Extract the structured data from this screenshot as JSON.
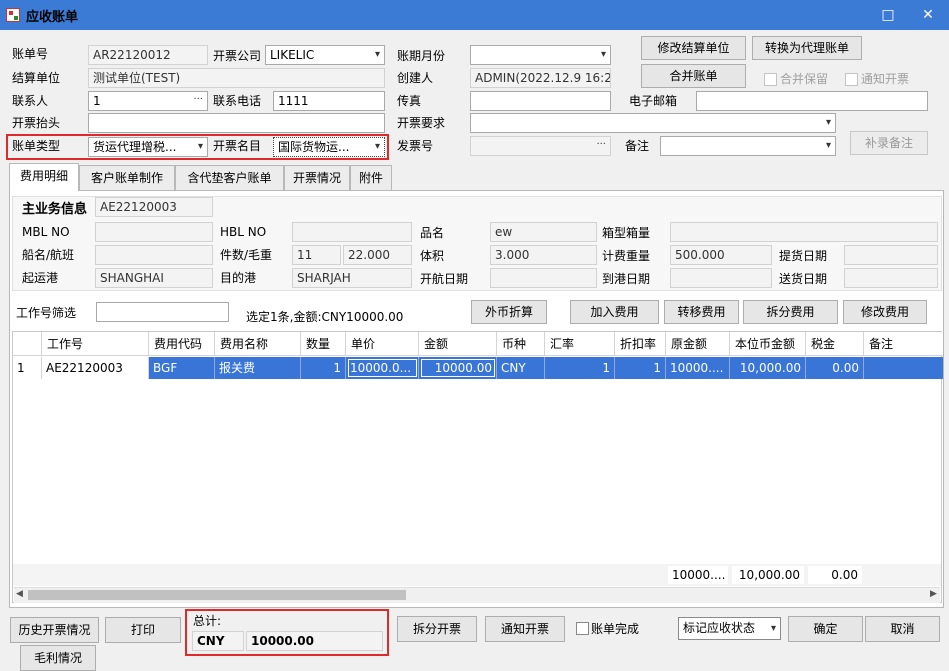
{
  "window": {
    "title": "应收账单",
    "maximize_icon": "□",
    "close_icon": "✕"
  },
  "form": {
    "bill_no": {
      "label": "账单号",
      "value": "AR22120012"
    },
    "invoice_company": {
      "label": "开票公司",
      "value": "LIKELIC"
    },
    "period": {
      "label": "账期月份",
      "value": ""
    },
    "settle_unit": {
      "label": "结算单位",
      "value": "测试单位(TEST)"
    },
    "creator": {
      "label": "创建人",
      "value": "ADMIN(2022.12.9 16:2:"
    },
    "contact": {
      "label": "联系人",
      "value": "1"
    },
    "phone": {
      "label": "联系电话",
      "value": "1111"
    },
    "fax": {
      "label": "传真",
      "value": ""
    },
    "email": {
      "label": "电子邮箱",
      "value": ""
    },
    "invoice_title": {
      "label": "开票抬头",
      "value": ""
    },
    "invoice_req": {
      "label": "开票要求",
      "value": ""
    },
    "bill_type": {
      "label": "账单类型",
      "value": "货运代理增税..."
    },
    "invoice_item": {
      "label": "开票名目",
      "value": "国际货物运..."
    },
    "invoice_no": {
      "label": "发票号",
      "value": ""
    },
    "remark": {
      "label": "备注",
      "value": ""
    }
  },
  "buttons": {
    "modify_settle": "修改结算单位",
    "to_agent": "转换为代理账单",
    "merge": "合并账单",
    "supplement": "补录备注",
    "foreign_convert": "外币折算",
    "add_fee": "加入费用",
    "transfer_fee": "转移费用",
    "split_fee": "拆分费用",
    "modify_fee": "修改费用",
    "history_invoice": "历史开票情况",
    "print": "打印",
    "profit": "毛利情况",
    "split_invoice": "拆分开票",
    "notify_invoice": "通知开票",
    "confirm": "确定",
    "cancel": "取消"
  },
  "checks": {
    "merge_keep": "合并保留",
    "notify_invoice": "通知开票",
    "bill_done": "账单完成"
  },
  "status_select": "标记应收状态",
  "tabs": [
    "费用明细",
    "客户账单制作",
    "含代垫客户账单",
    "开票情况",
    "附件"
  ],
  "biz": {
    "header": "主业务信息",
    "job_no": "AE22120003",
    "mbl": {
      "label": "MBL NO",
      "value": ""
    },
    "hbl": {
      "label": "HBL NO",
      "value": ""
    },
    "product": {
      "label": "品名",
      "value": "ew"
    },
    "container": {
      "label": "箱型箱量",
      "value": ""
    },
    "vessel": {
      "label": "船名/航班",
      "value": ""
    },
    "pieces": {
      "label": "件数/毛重",
      "pcs": "11",
      "weight": "22.000"
    },
    "volume": {
      "label": "体积",
      "value": "3.000"
    },
    "charge_weight": {
      "label": "计费重量",
      "value": "500.000"
    },
    "pickup_date": {
      "label": "提货日期",
      "value": ""
    },
    "pol": {
      "label": "起运港",
      "value": "SHANGHAI"
    },
    "pod": {
      "label": "目的港",
      "value": "SHARJAH"
    },
    "sail_date": {
      "label": "开航日期",
      "value": ""
    },
    "arrive_date": {
      "label": "到港日期",
      "value": ""
    },
    "delivery_date": {
      "label": "送货日期",
      "value": ""
    }
  },
  "filter": {
    "label": "工作号筛选",
    "value": "",
    "summary": "选定1条,金额:CNY10000.00"
  },
  "grid": {
    "columns": [
      "工作号",
      "费用代码",
      "费用名称",
      "数量",
      "单价",
      "金额",
      "币种",
      "汇率",
      "折扣率",
      "原金额",
      "本位币金额",
      "税金",
      "备注"
    ],
    "rows": [
      {
        "idx": "1",
        "job": "AE22120003",
        "code": "BGF",
        "name": "报关费",
        "qty": "1",
        "price": "10000.0...",
        "amount": "10000.00",
        "currency": "CNY",
        "rate": "1",
        "discount": "1",
        "orig": "10000....",
        "base": "10,000.00",
        "tax": "0.00",
        "note": ""
      }
    ],
    "footer": {
      "orig": "10000....",
      "base": "10,000.00",
      "tax": "0.00"
    }
  },
  "total": {
    "label": "总计:",
    "currency": "CNY",
    "amount": "10000.00"
  }
}
